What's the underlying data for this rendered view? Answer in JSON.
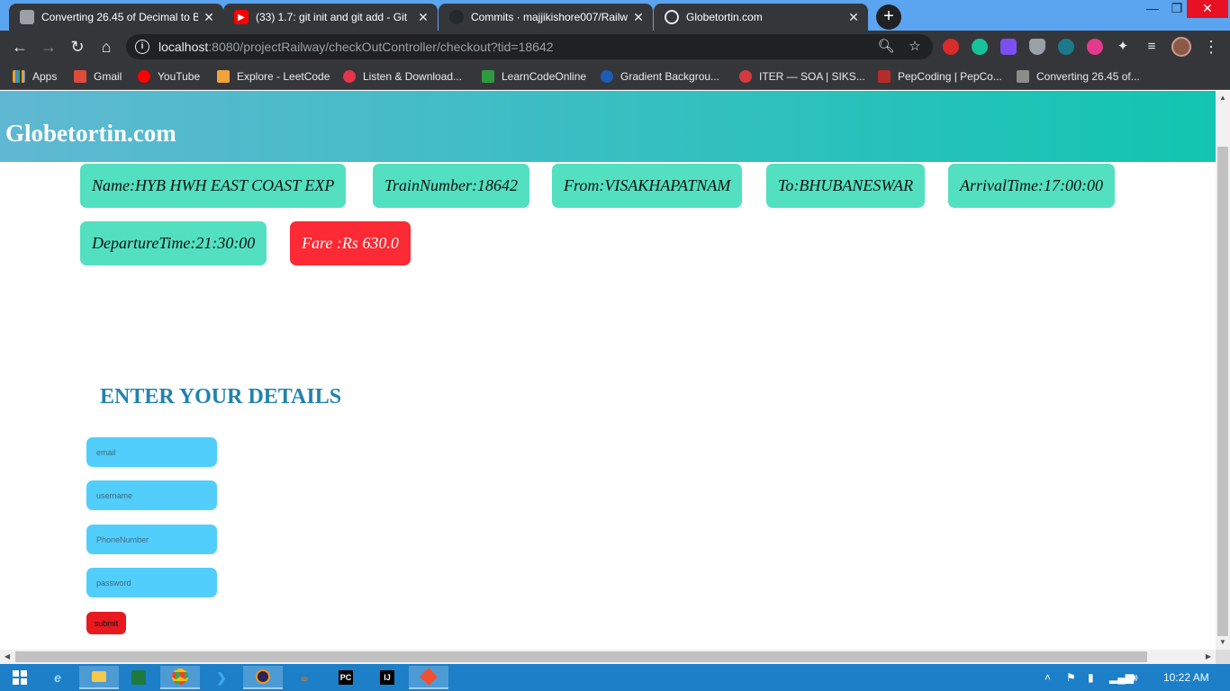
{
  "browser": {
    "tabs": [
      {
        "title": "Converting 26.45 of Decimal to B",
        "icon": "table-icon"
      },
      {
        "title": "(33) 1.7: git init and git add - Git",
        "icon": "youtube-icon"
      },
      {
        "title": "Commits · majjikishore007/Railw",
        "icon": "github-icon"
      },
      {
        "title": "Globetortin.com",
        "icon": "globe-icon"
      }
    ],
    "url_host": "localhost",
    "url_rest": ":8080/projectRailway/checkOutController/checkout?tid=18642",
    "bookmarks": [
      {
        "label": "Apps",
        "color": "#e8a02b"
      },
      {
        "label": "Gmail",
        "color": "#e04b3a"
      },
      {
        "label": "YouTube",
        "color": "#ff0000"
      },
      {
        "label": "Explore - LeetCode",
        "color": "#f3a33b"
      },
      {
        "label": "Listen & Download...",
        "color": "#e8344a"
      },
      {
        "label": "LearnCodeOnline",
        "color": "#2e9b3e"
      },
      {
        "label": "Gradient Backgrou...",
        "color": "#1a5fb4"
      },
      {
        "label": "ITER — SOA | SIKS...",
        "color": "#d43a3a"
      },
      {
        "label": "PepCoding | PepCo...",
        "color": "#b82b2b"
      },
      {
        "label": "Converting 26.45 of...",
        "color": "#8c8c8c"
      }
    ]
  },
  "site": {
    "title": "Globetortin.com",
    "train": {
      "name": "Name:HYB HWH EAST COAST EXP",
      "number": "TrainNumber:18642",
      "from": "From:VISAKHAPATNAM",
      "to": "To:BHUBANESWAR",
      "arrival": "ArrivalTime:17:00:00",
      "departure": "DepartureTime:21:30:00",
      "fare": "Fare :Rs 630.0"
    },
    "form": {
      "heading": "ENTER YOUR DETAILS",
      "email_placeholder": "email",
      "username_placeholder": "username",
      "phone_placeholder": "PhoneNumber",
      "password_placeholder": "password",
      "submit_label": "submit"
    }
  },
  "taskbar": {
    "clock": "10:22 AM"
  }
}
